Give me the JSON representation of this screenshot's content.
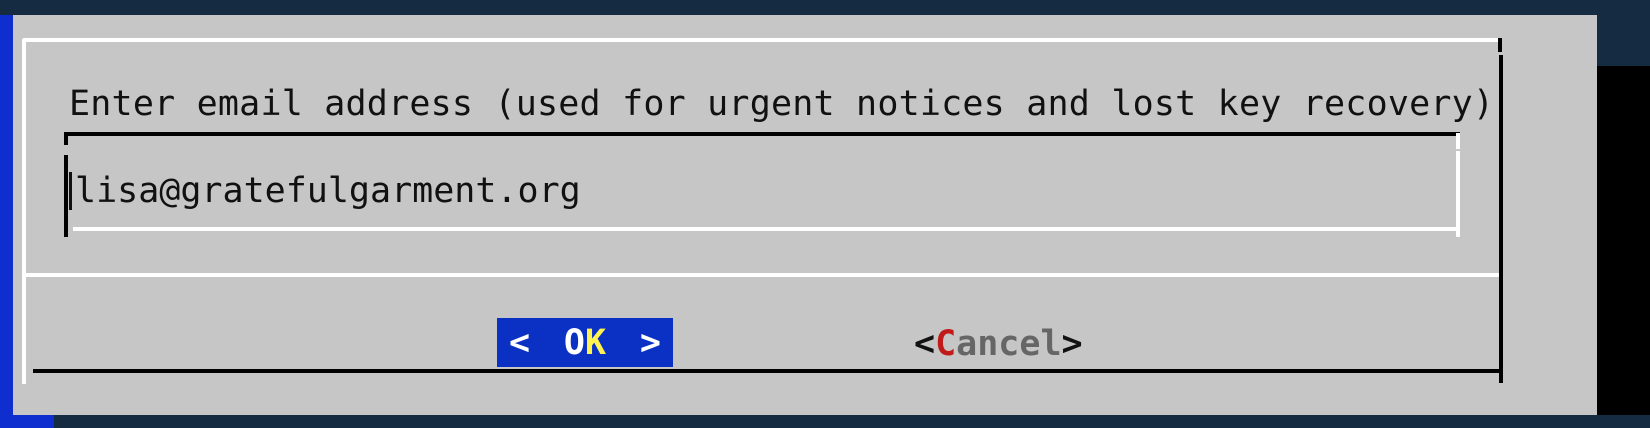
{
  "dialog": {
    "prompt": "Enter email address (used for urgent notices and lost key recovery)",
    "input": {
      "value": "lisa@gratefulgarment.org"
    },
    "buttons": {
      "ok": {
        "left_bracket": "<",
        "label_plain": "O",
        "label_hotkey": "K",
        "right_bracket": ">"
      },
      "cancel": {
        "left_bracket": "<",
        "label_hotkey": "C",
        "label_plain": "ancel",
        "right_bracket": ">"
      }
    }
  },
  "colors": {
    "terminal_background": "#142b42",
    "screen_accent": "#0f2ecf",
    "dialog_background": "#c6c6c6",
    "focused_button": "#0b31c4",
    "hotkey_focused": "#fff44f",
    "hotkey_unfocused": "#c11a1a"
  }
}
